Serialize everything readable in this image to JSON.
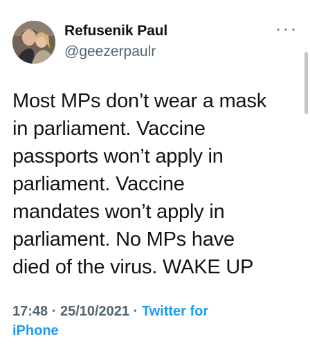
{
  "author": {
    "display_name": "Refusenik Paul",
    "handle": "@geezerpaulr"
  },
  "tweet": {
    "lines": [
      "Most MPs don’t wear a mask",
      "in parliament. Vaccine",
      "passports won’t apply in",
      "parliament. Vaccine",
      "mandates won’t apply in",
      "parliament. No MPs have",
      "died of the virus. WAKE UP"
    ],
    "time": "17:48",
    "date": "25/10/2021",
    "separator": "·",
    "source_line1": "Twitter for",
    "source_line2": "iPhone"
  },
  "icons": {
    "more": "more-options-icon",
    "avatar": "profile-photo"
  },
  "colors": {
    "text": "#0f1419",
    "secondary": "#536471",
    "link": "#1d9bf0"
  }
}
